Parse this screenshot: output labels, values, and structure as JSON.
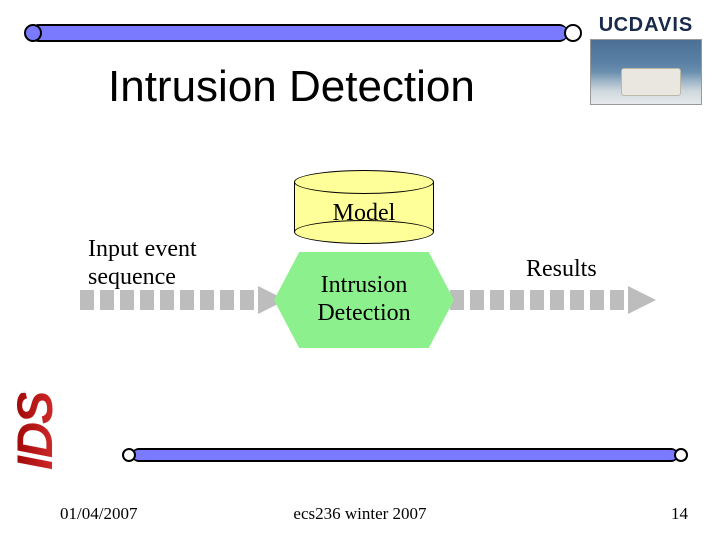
{
  "header": {
    "logo_uc": "UC",
    "logo_davis": "DAVIS"
  },
  "title": "Intrusion Detection",
  "diagram": {
    "model_label": "Model",
    "process_line1": "Intrusion",
    "process_line2": "Detection",
    "input_line1": "Input event",
    "input_line2": "sequence",
    "results_label": "Results"
  },
  "wordart": "IDS",
  "footer": {
    "date": "01/04/2007",
    "center": "ecs236 winter 2007",
    "page": "14"
  }
}
